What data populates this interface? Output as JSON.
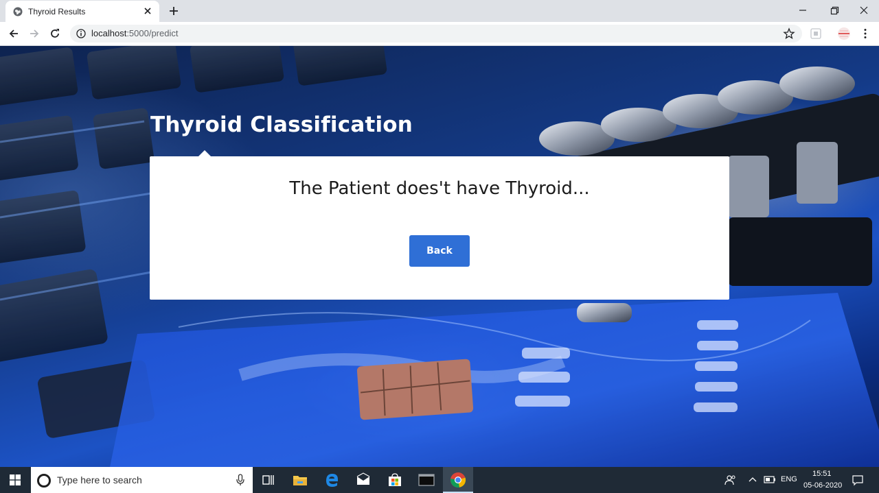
{
  "browser": {
    "tab_title": "Thyroid Results",
    "url_host": "localhost",
    "url_path": ":5000/predict"
  },
  "page": {
    "heading": "Thyroid Classification",
    "result_message": "The Patient does't have Thyroid...",
    "back_label": "Back",
    "accent_color": "#2f6fd6"
  },
  "taskbar": {
    "search_placeholder": "Type here to search",
    "language": "ENG",
    "time": "15:51",
    "date": "05-06-2020",
    "pinned_icons": [
      "task-view-icon",
      "file-explorer-icon",
      "edge-icon",
      "mail-icon",
      "store-icon",
      "terminal-icon",
      "chrome-icon"
    ]
  }
}
